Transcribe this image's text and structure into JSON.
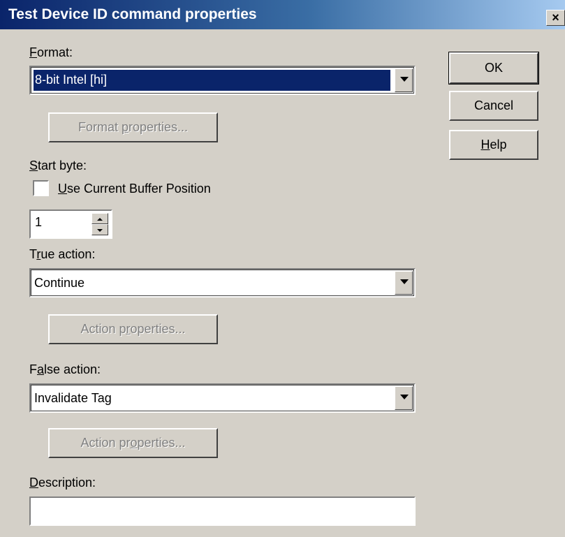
{
  "window": {
    "title": "Test Device ID command properties",
    "close_glyph": "×"
  },
  "format": {
    "label": "Format:",
    "accel": "F",
    "label_rest": "ormat:",
    "value": "8-bit Intel  [hi]",
    "properties_button": {
      "pre": "Format ",
      "accel": "p",
      "post": "roperties..."
    }
  },
  "start_byte": {
    "label_accel": "S",
    "label_rest": "tart byte:",
    "checkbox_accel": "U",
    "checkbox_rest": "se Current Buffer Position",
    "checkbox_checked": false,
    "value": "1"
  },
  "true_action": {
    "label_pre": "T",
    "label_accel": "r",
    "label_post": "ue action:",
    "value": "Continue",
    "properties_button": {
      "pre": "Action p",
      "accel": "r",
      "post": "operties..."
    }
  },
  "false_action": {
    "label_pre": "F",
    "label_accel": "a",
    "label_post": "lse action:",
    "value": "Invalidate Tag",
    "properties_button": {
      "pre": "Action pr",
      "accel": "o",
      "post": "perties..."
    }
  },
  "description": {
    "label_accel": "D",
    "label_rest": "escription:",
    "value": ""
  },
  "buttons": {
    "ok": "OK",
    "cancel": "Cancel",
    "help_accel": "H",
    "help_rest": "elp"
  },
  "colors": {
    "dialog_bg": "#d4d0c8",
    "title_start": "#0a246a",
    "title_end": "#a6caf0",
    "selection": "#0a246a"
  }
}
